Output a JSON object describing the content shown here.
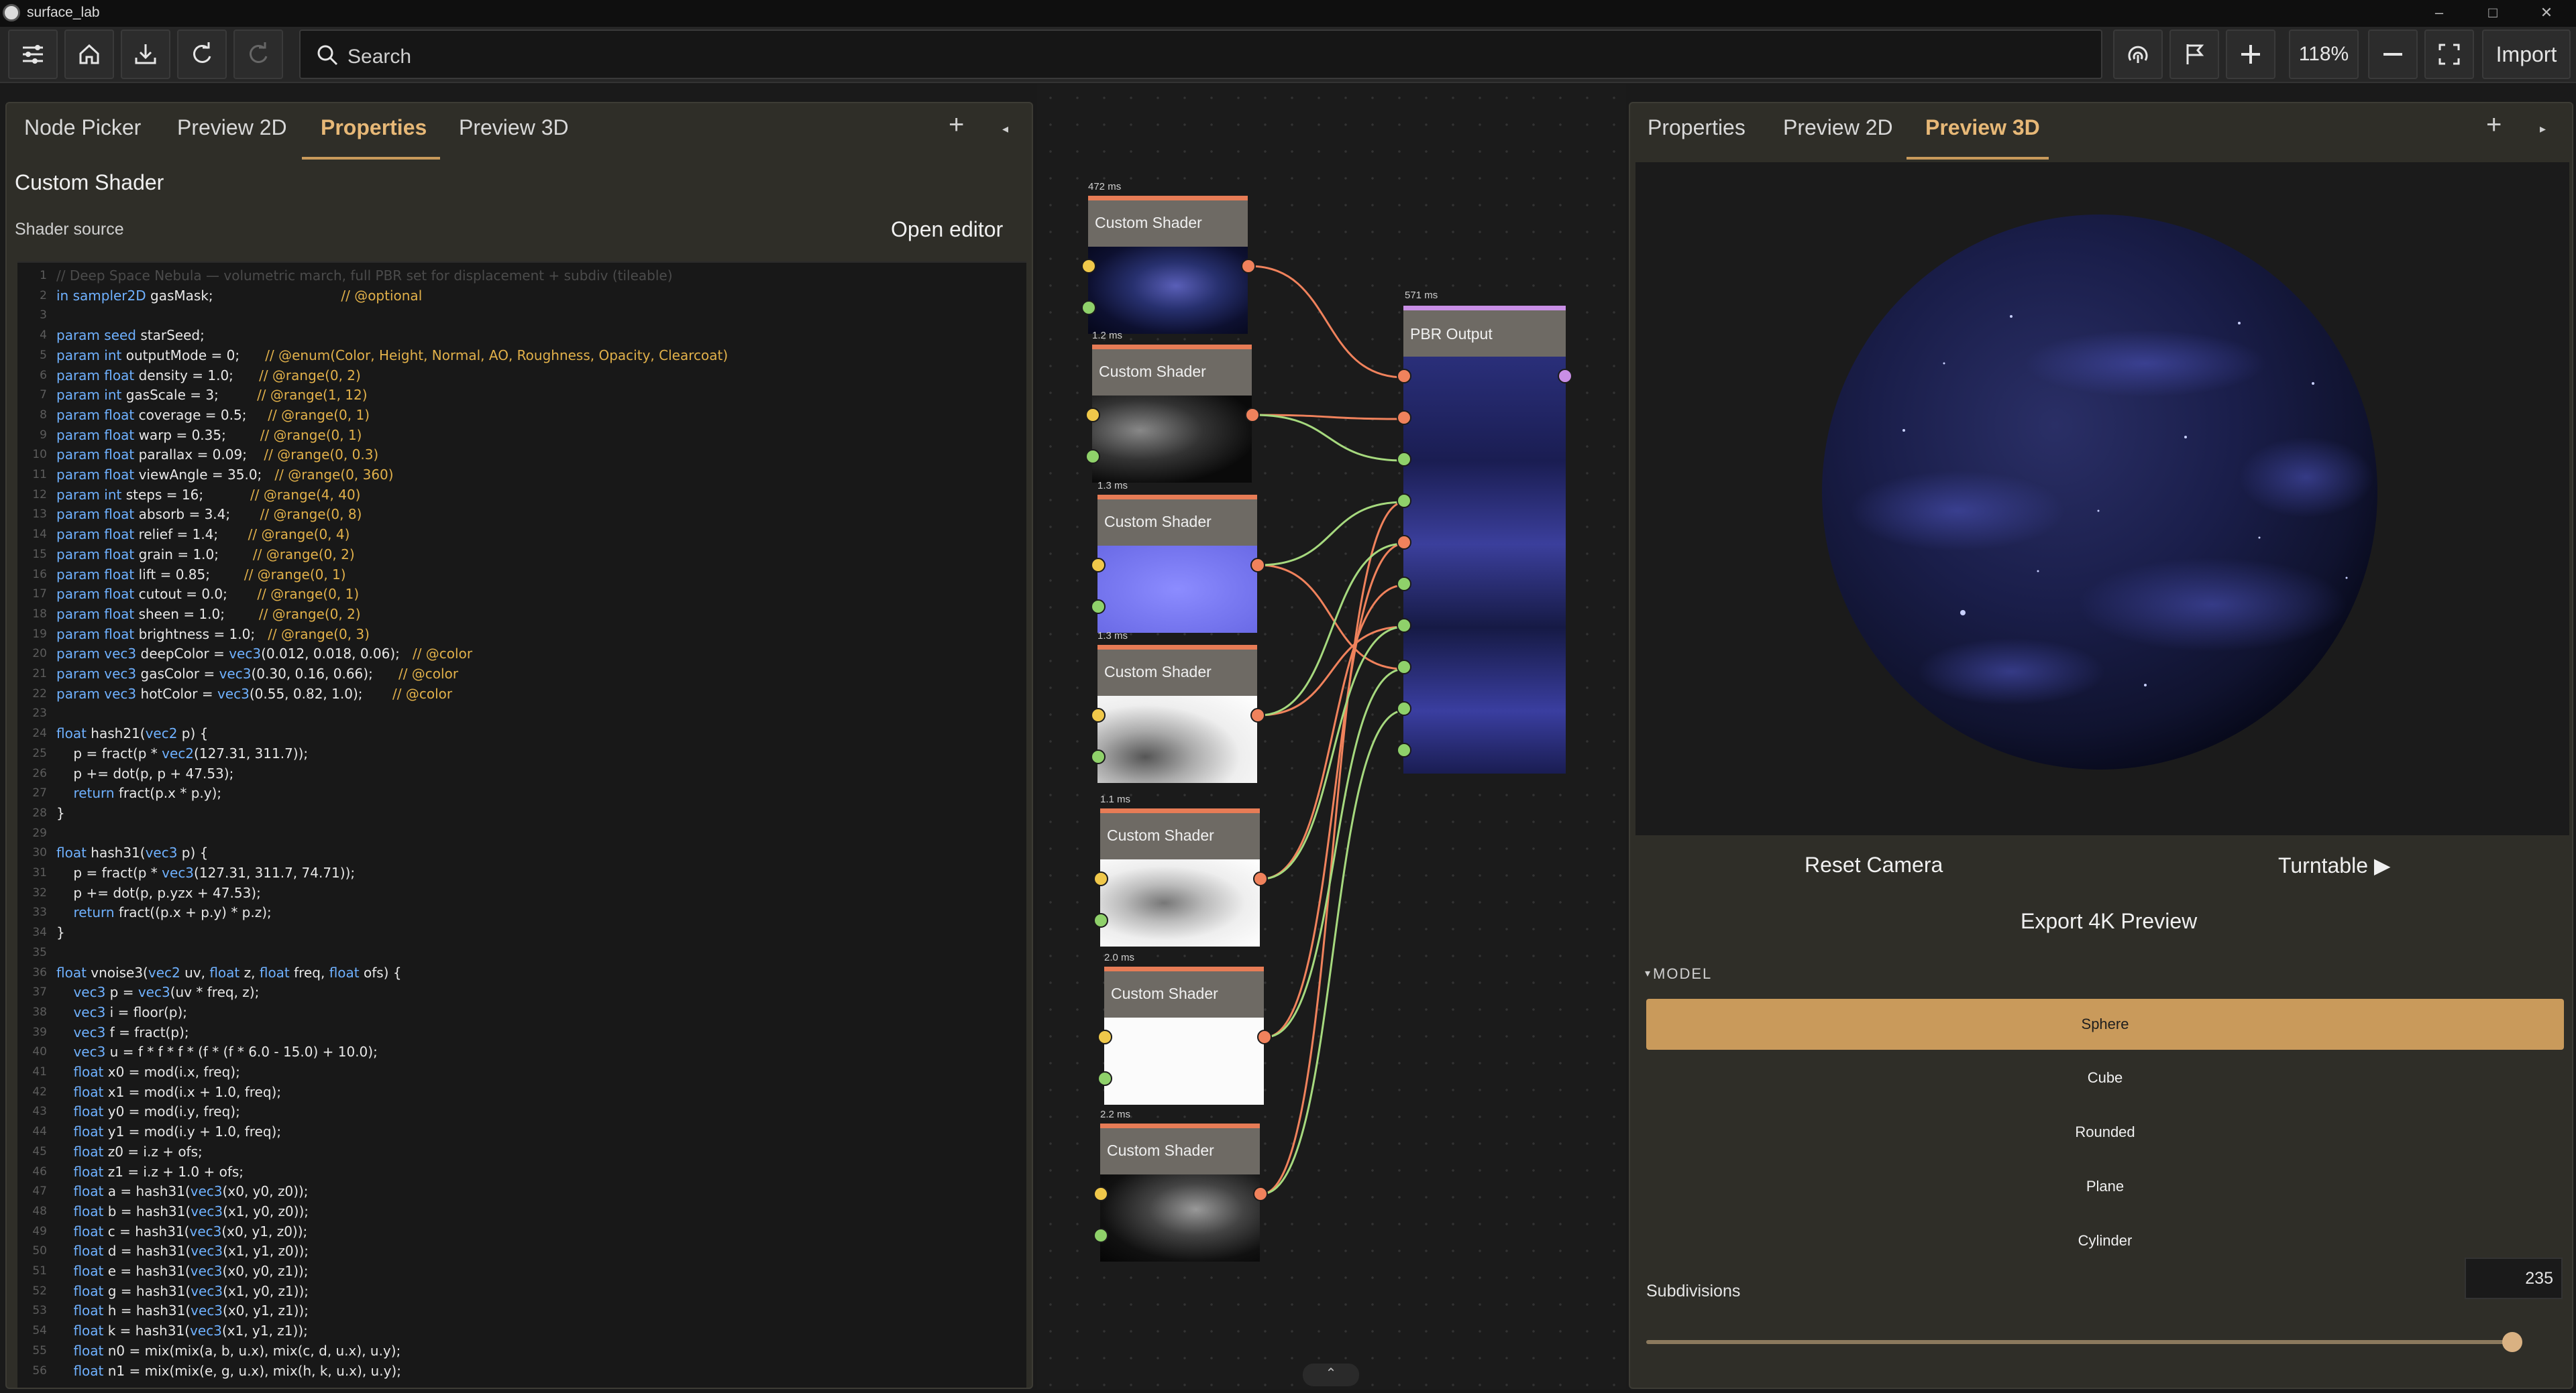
{
  "window": {
    "title": "surface_lab",
    "controls": [
      "–",
      "□",
      "✕"
    ]
  },
  "toolbar": {
    "buttons": [
      "menu-icon",
      "home-icon",
      "download-icon",
      "redo-icon",
      "refresh-icon"
    ],
    "search_placeholder": "Search",
    "zoom": "118%",
    "import_label": "Import"
  },
  "left_panel": {
    "tabs": [
      "Node Picker",
      "Preview 2D",
      "Properties",
      "Preview 3D"
    ],
    "active_tab": "Properties",
    "add_tab": "+",
    "collapse": "◂",
    "title": "Custom Shader",
    "source_label": "Shader source",
    "open_editor": "Open editor",
    "code_lines": [
      {
        "n": "1",
        "t": "// Deep Space Nebula — volumetric march, full PBR set for displacement + subdiv (tileable)"
      },
      {
        "n": "2",
        "t": "in sampler2D gasMask;                              // @optional"
      },
      {
        "n": "3",
        "t": ""
      },
      {
        "n": "4",
        "t": "param seed starSeed;"
      },
      {
        "n": "5",
        "t": "param int outputMode = 0;      // @enum(Color, Height, Normal, AO, Roughness, Opacity, Clearcoat)"
      },
      {
        "n": "6",
        "t": "param float density = 1.0;      // @range(0, 2)"
      },
      {
        "n": "7",
        "t": "param int gasScale = 3;         // @range(1, 12)"
      },
      {
        "n": "8",
        "t": "param float coverage = 0.5;     // @range(0, 1)"
      },
      {
        "n": "9",
        "t": "param float warp = 0.35;        // @range(0, 1)"
      },
      {
        "n": "10",
        "t": "param float parallax = 0.09;    // @range(0, 0.3)"
      },
      {
        "n": "11",
        "t": "param float viewAngle = 35.0;   // @range(0, 360)"
      },
      {
        "n": "12",
        "t": "param int steps = 16;           // @range(4, 40)"
      },
      {
        "n": "13",
        "t": "param float absorb = 3.4;       // @range(0, 8)"
      },
      {
        "n": "14",
        "t": "param float relief = 1.4;       // @range(0, 4)"
      },
      {
        "n": "15",
        "t": "param float grain = 1.0;        // @range(0, 2)"
      },
      {
        "n": "16",
        "t": "param float lift = 0.85;        // @range(0, 1)"
      },
      {
        "n": "17",
        "t": "param float cutout = 0.0;       // @range(0, 1)"
      },
      {
        "n": "18",
        "t": "param float sheen = 1.0;        // @range(0, 2)"
      },
      {
        "n": "19",
        "t": "param float brightness = 1.0;   // @range(0, 3)"
      },
      {
        "n": "20",
        "t": "param vec3 deepColor = vec3(0.012, 0.018, 0.06);   // @color"
      },
      {
        "n": "21",
        "t": "param vec3 gasColor = vec3(0.30, 0.16, 0.66);      // @color"
      },
      {
        "n": "22",
        "t": "param vec3 hotColor = vec3(0.55, 0.82, 1.0);       // @color"
      },
      {
        "n": "23",
        "t": ""
      },
      {
        "n": "24",
        "t": "float hash21(vec2 p) {"
      },
      {
        "n": "25",
        "t": "    p = fract(p * vec2(127.31, 311.7));"
      },
      {
        "n": "26",
        "t": "    p += dot(p, p + 47.53);"
      },
      {
        "n": "27",
        "t": "    return fract(p.x * p.y);"
      },
      {
        "n": "28",
        "t": "}"
      },
      {
        "n": "29",
        "t": ""
      },
      {
        "n": "30",
        "t": "float hash31(vec3 p) {"
      },
      {
        "n": "31",
        "t": "    p = fract(p * vec3(127.31, 311.7, 74.71));"
      },
      {
        "n": "32",
        "t": "    p += dot(p, p.yzx + 47.53);"
      },
      {
        "n": "33",
        "t": "    return fract((p.x + p.y) * p.z);"
      },
      {
        "n": "34",
        "t": "}"
      },
      {
        "n": "35",
        "t": ""
      },
      {
        "n": "36",
        "t": "float vnoise3(vec2 uv, float z, float freq, float ofs) {"
      },
      {
        "n": "37",
        "t": "    vec3 p = vec3(uv * freq, z);"
      },
      {
        "n": "38",
        "t": "    vec3 i = floor(p);"
      },
      {
        "n": "39",
        "t": "    vec3 f = fract(p);"
      },
      {
        "n": "40",
        "t": "    vec3 u = f * f * f * (f * (f * 6.0 - 15.0) + 10.0);"
      },
      {
        "n": "41",
        "t": "    float x0 = mod(i.x, freq);"
      },
      {
        "n": "42",
        "t": "    float x1 = mod(i.x + 1.0, freq);"
      },
      {
        "n": "43",
        "t": "    float y0 = mod(i.y, freq);"
      },
      {
        "n": "44",
        "t": "    float y1 = mod(i.y + 1.0, freq);"
      },
      {
        "n": "45",
        "t": "    float z0 = i.z + ofs;"
      },
      {
        "n": "46",
        "t": "    float z1 = i.z + 1.0 + ofs;"
      },
      {
        "n": "47",
        "t": "    float a = hash31(vec3(x0, y0, z0));"
      },
      {
        "n": "48",
        "t": "    float b = hash31(vec3(x1, y0, z0));"
      },
      {
        "n": "49",
        "t": "    float c = hash31(vec3(x0, y1, z0));"
      },
      {
        "n": "50",
        "t": "    float d = hash31(vec3(x1, y1, z0));"
      },
      {
        "n": "51",
        "t": "    float e = hash31(vec3(x0, y0, z1));"
      },
      {
        "n": "52",
        "t": "    float g = hash31(vec3(x1, y0, z1));"
      },
      {
        "n": "53",
        "t": "    float h = hash31(vec3(x0, y1, z1));"
      },
      {
        "n": "54",
        "t": "    float k = hash31(vec3(x1, y1, z1));"
      },
      {
        "n": "55",
        "t": "    float n0 = mix(mix(a, b, u.x), mix(c, d, u.x), u.y);"
      },
      {
        "n": "56",
        "t": "    float n1 = mix(mix(e, g, u.x), mix(h, k, u.x), u.y);"
      }
    ]
  },
  "graph": {
    "nodes": [
      {
        "title": "Custom Shader",
        "time": "472 ms"
      },
      {
        "title": "Custom Shader",
        "time": "1.2 ms"
      },
      {
        "title": "Custom Shader",
        "time": "1.3 ms"
      },
      {
        "title": "Custom Shader",
        "time": "1.3 ms"
      },
      {
        "title": "Custom Shader",
        "time": "1.1 ms"
      },
      {
        "title": "Custom Shader",
        "time": "2.0 ms"
      },
      {
        "title": "Custom Shader",
        "time": "2.2 ms"
      }
    ],
    "output_node": {
      "title": "PBR Output",
      "time": "571 ms"
    },
    "collapse": "⌃"
  },
  "right_panel": {
    "tabs": [
      "Properties",
      "Preview 2D",
      "Preview 3D"
    ],
    "active_tab": "Preview 3D",
    "add_tab": "+",
    "collapse": "▸",
    "reset_camera": "Reset Camera",
    "turntable": "Turntable ▶",
    "export": "Export 4K Preview",
    "model_header": "MODEL",
    "model_toggle": "▾",
    "models": [
      "Sphere",
      "Cube",
      "Rounded",
      "Plane",
      "Cylinder"
    ],
    "selected_model": "Sphere",
    "subdivisions_label": "Subdivisions",
    "subdivisions_value": "235",
    "subdivisions_fraction": 0.99
  },
  "colors": {
    "accent": "#c99a5b",
    "accent_text": "#e7b877",
    "node_header": "#e77c56",
    "output_header": "#c98fe6"
  }
}
